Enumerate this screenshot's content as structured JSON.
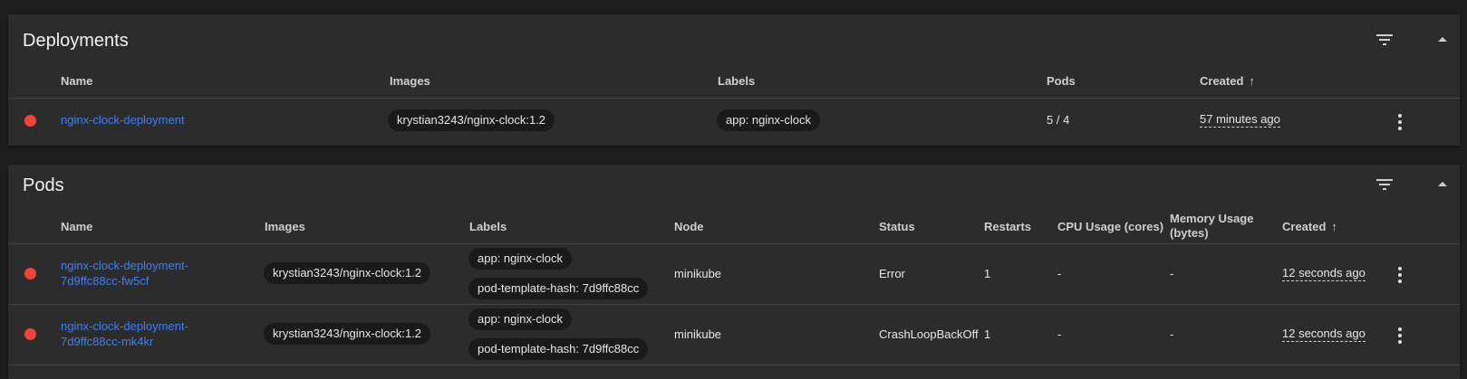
{
  "deployments": {
    "title": "Deployments",
    "icons": {
      "filter": "filter-list-icon",
      "collapse": "arrow-up-icon"
    },
    "columns": {
      "name": "Name",
      "images": "Images",
      "labels": "Labels",
      "pods": "Pods",
      "created": "Created",
      "sort_indicator": "↑"
    },
    "rows": [
      {
        "status": "error",
        "name": "nginx-clock-deployment",
        "image": "krystian3243/nginx-clock:1.2",
        "label": "app: nginx-clock",
        "pods": "5 / 4",
        "created": "57 minutes ago"
      }
    ]
  },
  "pods": {
    "title": "Pods",
    "icons": {
      "filter": "filter-list-icon",
      "collapse": "arrow-up-icon"
    },
    "columns": {
      "name": "Name",
      "images": "Images",
      "labels": "Labels",
      "node": "Node",
      "status": "Status",
      "restarts": "Restarts",
      "cpu": "CPU Usage (cores)",
      "memory_line1": "Memory Usage",
      "memory_line2": "(bytes)",
      "created": "Created",
      "sort_indicator": "↑"
    },
    "rows": [
      {
        "status_color": "error",
        "name_line1": "nginx-clock-deployment-",
        "name_line2": "7d9ffc88cc-fw5cf",
        "image": "krystian3243/nginx-clock:1.2",
        "label1": "app: nginx-clock",
        "label2": "pod-template-hash: 7d9ffc88cc",
        "node": "minikube",
        "status": "Error",
        "restarts": "1",
        "cpu": "-",
        "memory": "-",
        "created": "12 seconds ago"
      },
      {
        "status_color": "error",
        "name_line1": "nginx-clock-deployment-",
        "name_line2": "7d9ffc88cc-mk4kr",
        "image": "krystian3243/nginx-clock:1.2",
        "label1": "app: nginx-clock",
        "label2": "pod-template-hash: 7d9ffc88cc",
        "node": "minikube",
        "status": "CrashLoopBackOff",
        "restarts": "1",
        "cpu": "-",
        "memory": "-",
        "created": "12 seconds ago"
      }
    ]
  },
  "colors": {
    "error": "#f44336",
    "link": "#3d80f5",
    "card": "#2c2c2c",
    "background": "#1e1e1e"
  }
}
